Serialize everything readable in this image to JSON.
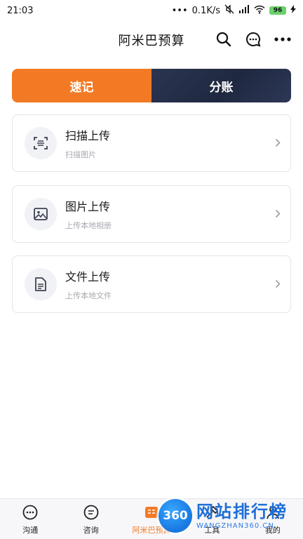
{
  "status_bar": {
    "time": "21:03",
    "speed": "0.1K/s",
    "battery": "96"
  },
  "header": {
    "title": "阿米巴预算"
  },
  "tabs": [
    {
      "label": "速记",
      "active": true
    },
    {
      "label": "分账",
      "active": false
    }
  ],
  "cards": [
    {
      "title": "扫描上传",
      "subtitle": "扫描图片",
      "icon": "scan-icon"
    },
    {
      "title": "图片上传",
      "subtitle": "上传本地相册",
      "icon": "image-icon"
    },
    {
      "title": "文件上传",
      "subtitle": "上传本地文件",
      "icon": "file-icon"
    }
  ],
  "bottom_nav": [
    {
      "label": "沟通",
      "icon": "chat-icon",
      "active": false
    },
    {
      "label": "咨询",
      "icon": "consult-icon",
      "active": false
    },
    {
      "label": "阿米巴预算",
      "icon": "budget-icon",
      "active": true
    },
    {
      "label": "工具",
      "icon": "tools-icon",
      "active": false
    },
    {
      "label": "我的",
      "icon": "profile-icon",
      "active": false
    }
  ],
  "watermark": {
    "badge": "360",
    "cn": "网站排行榜",
    "en": "WANGZHAN360.CN"
  },
  "colors": {
    "accent": "#f37a24",
    "dark_tab": "#1f2840",
    "card_border": "#e3e5ea",
    "subtext": "#a7a9b0"
  }
}
